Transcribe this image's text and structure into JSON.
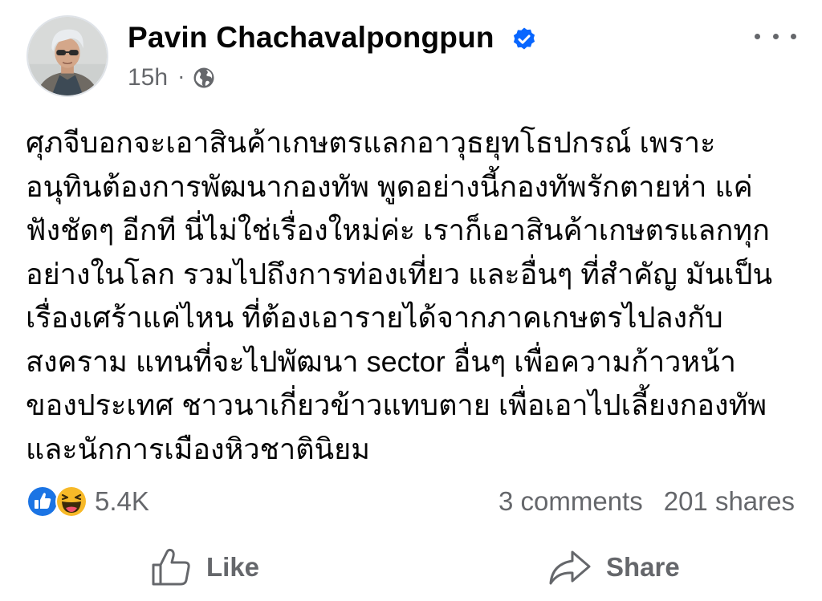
{
  "post": {
    "author": "Pavin Chachavalpongpun",
    "verified": true,
    "timestamp": "15h",
    "separator": "·",
    "audience_icon": "globe-icon",
    "text_lines": [
      "ศุภจีบอกจะเอาสินค้าเกษตรแลกอาวุธยุทโธปกรณ์ เพราะ",
      "อนุทินต้องการพัฒนากองทัพ พูดอย่างนี้กองทัพรักตายห่า แค่",
      "ฟังชัดๆ อีกที นี่ไม่ใช่เรื่องใหม่ค่ะ เราก็เอาสินค้าเกษตรแลกทุก",
      "อย่างในโลก รวมไปถึงการท่องเที่ยว และอื่นๆ ที่สำคัญ มันเป็น",
      "เรื่องเศร้าแค่ไหน ที่ต้องเอารายได้จากภาคเกษตรไปลงกับ",
      "สงคราม แทนที่จะไปพัฒนา sector อื่นๆ เพื่อความก้าวหน้า",
      "ของประเทศ ชาวนาเกี่ยวข้าวแทบตาย เพื่อเอาไปเลี้ยงกองทัพ",
      "และนักการเมืองหิวชาตินิยม"
    ]
  },
  "reactions": {
    "icons": [
      "like-reaction-icon",
      "haha-reaction-icon"
    ],
    "count": "5.4K"
  },
  "engagement": {
    "comments": "3 comments",
    "shares": "201 shares"
  },
  "actions": {
    "like_label": "Like",
    "share_label": "Share"
  },
  "colors": {
    "verified": "#0866ff",
    "secondary_text": "#65676b",
    "like_blue": "#1b74e4",
    "haha_yellow": "#f7b928"
  }
}
